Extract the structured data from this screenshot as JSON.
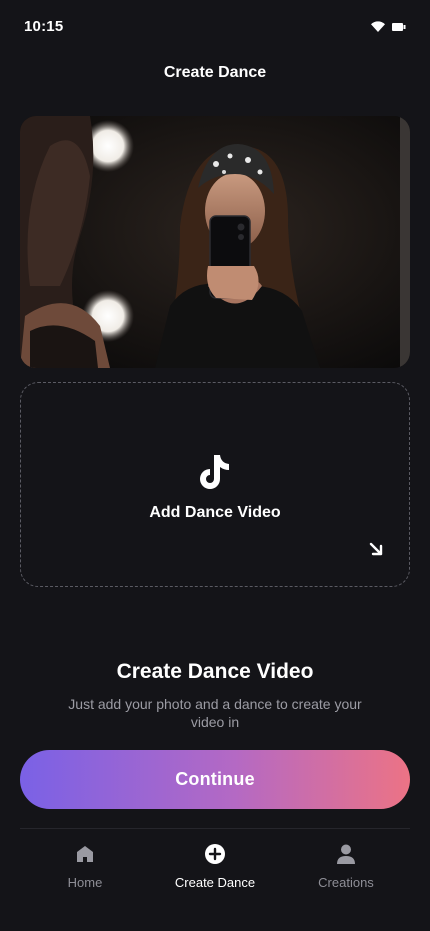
{
  "status_bar": {
    "time": "10:15",
    "icons": [
      "wifi-icon",
      "battery-icon"
    ]
  },
  "header": {
    "title": "Create Dance"
  },
  "photo": {
    "description_icon": "photo-preview"
  },
  "upload": {
    "label": "Add Dance Video",
    "icon": "tiktok-icon",
    "corner_icon": "arrow-down-right-icon"
  },
  "promo": {
    "title": "Create Dance Video",
    "description": "Just add your photo and a dance to create your video in"
  },
  "continue_label": "Continue",
  "tabs": [
    {
      "label": "Home",
      "icon": "home-icon",
      "active": false
    },
    {
      "label": "Create Dance",
      "icon": "plus-circle-icon",
      "active": true
    },
    {
      "label": "Creations",
      "icon": "user-icon",
      "active": false
    }
  ],
  "colors": {
    "background": "#141418",
    "gradient_start": "#7a61e6",
    "gradient_end": "#ec7385"
  }
}
